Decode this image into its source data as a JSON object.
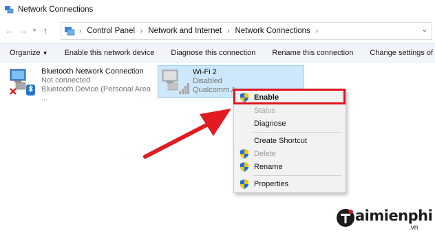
{
  "window": {
    "title": "Network Connections"
  },
  "address_bar": {
    "crumbs": [
      "Control Panel",
      "Network and Internet",
      "Network Connections"
    ]
  },
  "command_bar": {
    "organize": "Organize",
    "enable_device": "Enable this network device",
    "diagnose": "Diagnose this connection",
    "rename": "Rename this connection",
    "change_settings": "Change settings of this conn"
  },
  "connections": [
    {
      "name": "Bluetooth Network Connection",
      "status": "Not connected",
      "device": "Bluetooth Device (Personal Area ..."
    },
    {
      "name": "Wi-Fi 2",
      "status": "Disabled",
      "device": "Qualcomm A"
    }
  ],
  "context_menu": {
    "items": [
      {
        "label": "Enable",
        "icon": "shield-icon",
        "disabled": false
      },
      {
        "label": "Status",
        "icon": "",
        "disabled": true
      },
      {
        "label": "Diagnose",
        "icon": "",
        "disabled": false
      },
      {
        "label": "Create Shortcut",
        "icon": "",
        "disabled": false
      },
      {
        "label": "Delete",
        "icon": "shield-icon",
        "disabled": true
      },
      {
        "label": "Rename",
        "icon": "shield-icon",
        "disabled": false
      },
      {
        "label": "Properties",
        "icon": "shield-icon",
        "disabled": false
      }
    ]
  },
  "watermark": {
    "brand": "aimienphi",
    "suffix": ".vn"
  },
  "colors": {
    "highlight": "#e0131d",
    "selection": "#cce8fa",
    "arrow": "#e01b22"
  }
}
